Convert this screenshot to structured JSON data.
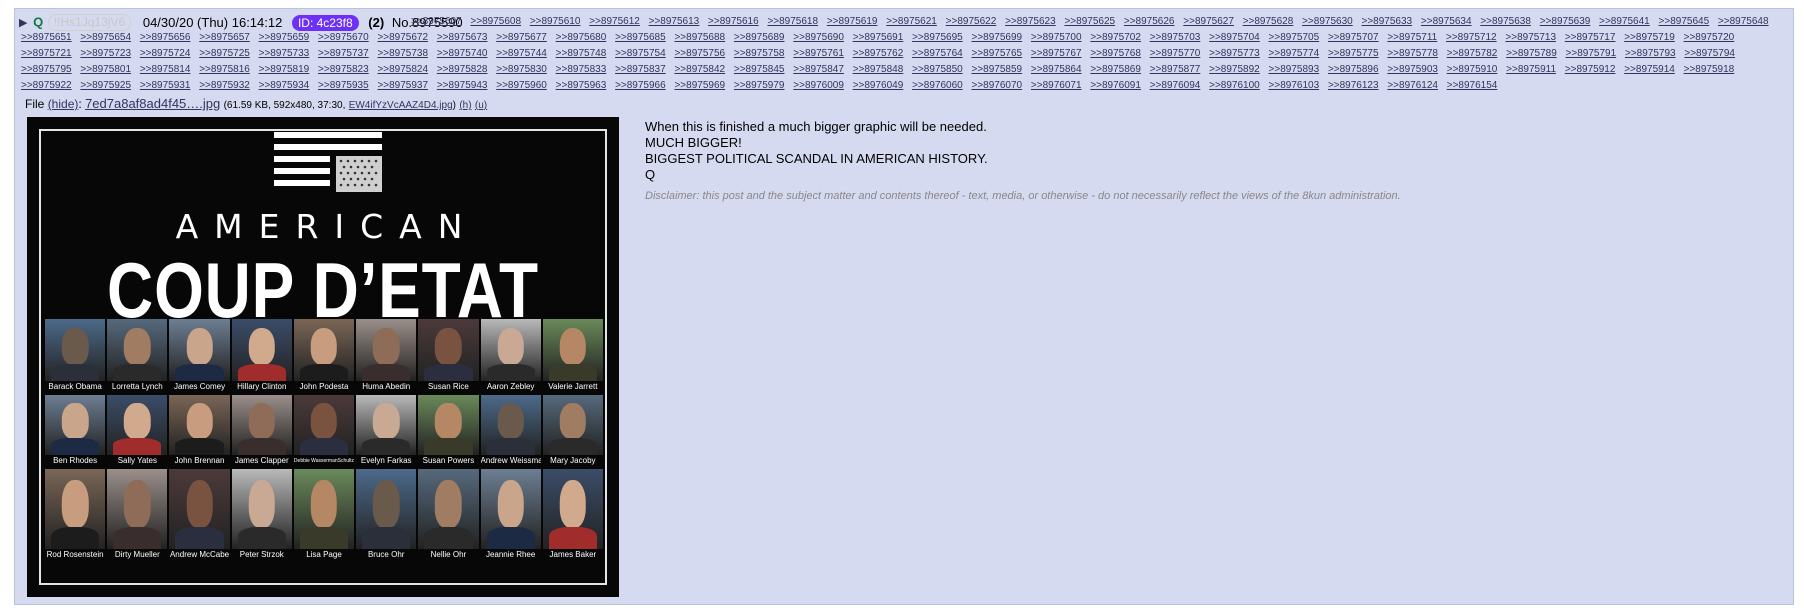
{
  "post": {
    "arrow": "▶",
    "name": "Q",
    "tripcode": "!!Hs1Jq13jV6",
    "date": "04/30/20 (Thu) 16:14:12",
    "poster_id": "ID: 4c23f8",
    "id_count": "(2)",
    "post_number": "No.8975590",
    "accent_colors": {
      "name": "#117743",
      "poster_id": "#6d31f6",
      "link": "#34345c",
      "background": "#d6daf0"
    }
  },
  "backlinks": [
    ">>8975607",
    ">>8975608",
    ">>8975610",
    ">>8975612",
    ">>8975613",
    ">>8975616",
    ">>8975618",
    ">>8975619",
    ">>8975621",
    ">>8975622",
    ">>8975623",
    ">>8975625",
    ">>8975626",
    ">>8975627",
    ">>8975628",
    ">>8975630",
    ">>8975633",
    ">>8975634",
    ">>8975638",
    ">>8975639",
    ">>8975641",
    ">>8975645",
    ">>8975648",
    ">>8975651",
    ">>8975654",
    ">>8975656",
    ">>8975657",
    ">>8975659",
    ">>8975670",
    ">>8975672",
    ">>8975673",
    ">>8975677",
    ">>8975680",
    ">>8975685",
    ">>8975688",
    ">>8975689",
    ">>8975690",
    ">>8975691",
    ">>8975695",
    ">>8975699",
    ">>8975700",
    ">>8975702",
    ">>8975703",
    ">>8975704",
    ">>8975705",
    ">>8975707",
    ">>8975711",
    ">>8975712",
    ">>8975713",
    ">>8975717",
    ">>8975719",
    ">>8975720",
    ">>8975721",
    ">>8975723",
    ">>8975724",
    ">>8975725",
    ">>8975733",
    ">>8975737",
    ">>8975738",
    ">>8975740",
    ">>8975744",
    ">>8975748",
    ">>8975754",
    ">>8975756",
    ">>8975758",
    ">>8975761",
    ">>8975762",
    ">>8975764",
    ">>8975765",
    ">>8975767",
    ">>8975768",
    ">>8975770",
    ">>8975773",
    ">>8975774",
    ">>8975775",
    ">>8975778",
    ">>8975782",
    ">>8975789",
    ">>8975791",
    ">>8975793",
    ">>8975794",
    ">>8975795",
    ">>8975801",
    ">>8975814",
    ">>8975816",
    ">>8975819",
    ">>8975823",
    ">>8975824",
    ">>8975828",
    ">>8975830",
    ">>8975833",
    ">>8975837",
    ">>8975842",
    ">>8975845",
    ">>8975847",
    ">>8975848",
    ">>8975850",
    ">>8975859",
    ">>8975864",
    ">>8975869",
    ">>8975877",
    ">>8975892",
    ">>8975893",
    ">>8975896",
    ">>8975903",
    ">>8975910",
    ">>8975911",
    ">>8975912",
    ">>8975914",
    ">>8975918",
    ">>8975922",
    ">>8975925",
    ">>8975931",
    ">>8975932",
    ">>8975934",
    ">>8975935",
    ">>8975937",
    ">>8975943",
    ">>8975960",
    ">>8975963",
    ">>8975966",
    ">>8975969",
    ">>8975979",
    ">>8976009",
    ">>8976049",
    ">>8976060",
    ">>8976070",
    ">>8976071",
    ">>8976091",
    ">>8976094",
    ">>8976100",
    ">>8976103",
    ">>8976123",
    ">>8976124",
    ">>8976154"
  ],
  "file": {
    "label": "File",
    "hide_label": "(hide)",
    "filename": "7ed7a8af8ad4f45….jpg",
    "meta": "(61.59 KB, 592x480, 37:30,",
    "original_name": "EW4ifYzVcAAZ4D4.jpg",
    "meta_close": ")",
    "h_link": "(h)",
    "u_link": "(u)"
  },
  "image": {
    "line1": "AMERICAN",
    "line2": "COUP D’ETAT",
    "rows": [
      [
        "Barack Obama",
        "Lorretta Lynch",
        "James Comey",
        "Hillary Clinton",
        "John Podesta",
        "Huma Abedin",
        "Susan Rice",
        "Aaron Zebley",
        "Valerie Jarrett"
      ],
      [
        "Ben Rhodes",
        "Sally Yates",
        "John Brennan",
        "James Clapper",
        "Debbie WassermanSchultz",
        "Evelyn Farkas",
        "Susan Powers",
        "Andrew Weissmann",
        "Mary Jacoby"
      ],
      [
        "Rod Rosenstein",
        "Dirty Mueller",
        "Andrew McCabe",
        "Peter Strzok",
        "Lisa Page",
        "Bruce Ohr",
        "Nellie Ohr",
        "Jeannie Rhee",
        "James Baker"
      ]
    ]
  },
  "comment": {
    "lines": [
      "When this is finished a much bigger graphic will be needed.",
      "MUCH BIGGER!",
      "BIGGEST POLITICAL SCANDAL IN AMERICAN HISTORY.",
      "Q"
    ],
    "disclaimer": "Disclaimer: this post and the subject matter and contents thereof - text, media, or otherwise - do not necessarily reflect the views of the 8kun administration."
  }
}
